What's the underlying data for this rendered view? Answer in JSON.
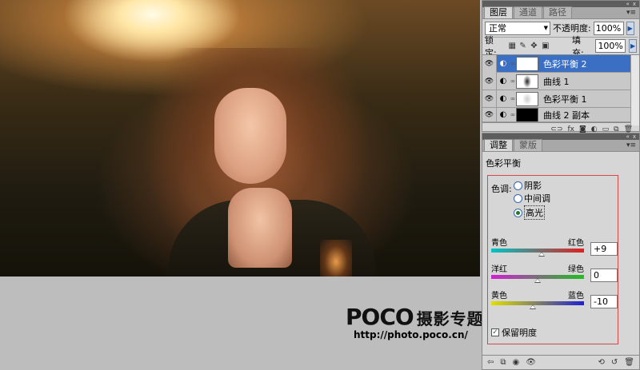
{
  "watermark": {
    "logo": "POCO",
    "logo_sub": "摄影专题",
    "url": "http://photo.poco.cn/"
  },
  "layers_panel": {
    "titlebar_icons": [
      "«",
      "x"
    ],
    "tabs": [
      "图层",
      "通道",
      "路径"
    ],
    "active_tab": 0,
    "blend_mode": "正常",
    "opacity_label": "不透明度:",
    "opacity_value": "100%",
    "lock_label": "锁定:",
    "fill_label": "填充:",
    "fill_value": "100%",
    "layers": [
      {
        "name": "色彩平衡 2",
        "selected": true
      },
      {
        "name": "曲线 1",
        "selected": false
      },
      {
        "name": "色彩平衡 1",
        "selected": false
      },
      {
        "name": "曲线 2 副本",
        "selected": false
      }
    ]
  },
  "adjustments_panel": {
    "titlebar_icons": [
      "«",
      "x"
    ],
    "tabs": [
      "调整",
      "蒙版"
    ],
    "active_tab": 0,
    "title": "色彩平衡",
    "tone_label": "色调:",
    "tone_options": [
      "阴影",
      "中间调",
      "高光"
    ],
    "tone_selected": 2,
    "sliders": [
      {
        "left": "青色",
        "right": "红色",
        "value": "+9",
        "position": 0.545,
        "gradient": [
          "#00c4c4",
          "#e02020"
        ]
      },
      {
        "left": "洋红",
        "right": "绿色",
        "value": "0",
        "position": 0.5,
        "gradient": [
          "#d020d0",
          "#20c020"
        ]
      },
      {
        "left": "黄色",
        "right": "蓝色",
        "value": "-10",
        "position": 0.45,
        "gradient": [
          "#e0e000",
          "#2020d0"
        ]
      }
    ],
    "preserve_luminosity_label": "保留明度",
    "preserve_luminosity_checked": true
  },
  "colors": {
    "selected_layer": "#3a6fc4",
    "highlight_box": "#d14a4a",
    "canvas_bg": "#bdbdbd"
  }
}
